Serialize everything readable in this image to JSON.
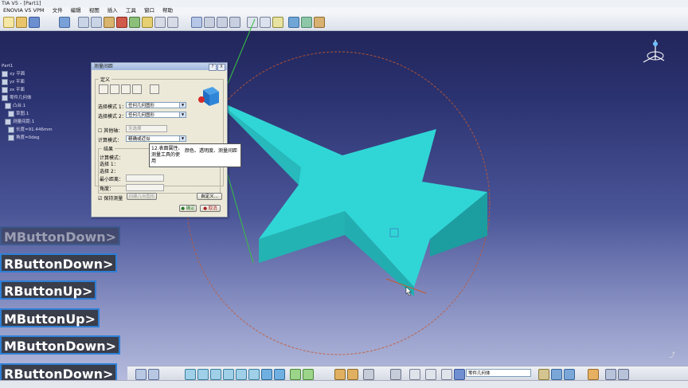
{
  "window": {
    "title": "TIA V5 - [Part1]"
  },
  "menu": [
    "ENOVIA V5 VPM",
    "文件",
    "编辑",
    "视图",
    "插入",
    "工具",
    "窗口",
    "帮助"
  ],
  "tree": [
    "Part1",
    "xy 平面",
    "yz 平面",
    "zx 平面",
    "零件几何体",
    "凸台.1",
    "草图.1",
    "测量间距.1",
    "长度=91.446mm",
    "角度=0deg"
  ],
  "dialog": {
    "title": "测量间距",
    "header_buttons": [
      "?",
      "X"
    ],
    "definition_group": "定义",
    "mode1_label": "选择模式 1：",
    "mode1_value": "任何几何图形",
    "mode2_label": "选择模式 2：",
    "mode2_value": "任何几何图形",
    "other_axis_label": "其他轴：",
    "other_axis_value": "无选择",
    "calc_mode_label": "计算模式：",
    "calc_mode_value": "精确或近似",
    "results_group": "结果",
    "results_calc_label": "计算模式：",
    "select1_label": "选择 1：",
    "select2_label": "选择 2：",
    "min_distance_label": "最小距离：",
    "angle_label": "角度：",
    "keep_measure_label": "保持测量",
    "create_geometry_label": "创建几何图形",
    "customize_label": "自定义...",
    "ok_label": "确定",
    "cancel_label": "取消"
  },
  "tooltip": {
    "left": "12.表面属性、测量工具的使用",
    "right": "颜色、透明度、测量间距"
  },
  "events": [
    "MButtonDown>",
    "RButtonDown>",
    "RButtonUp>",
    "MButtonUp>",
    "MButtonDown>",
    "RButtonDown>"
  ],
  "bottom_toolbar": {
    "body_select": "零件几何体"
  },
  "colors": {
    "star_top": "#2fd6d6",
    "star_side": "#1fa8aa",
    "accent_border": "#2e7fd6"
  }
}
